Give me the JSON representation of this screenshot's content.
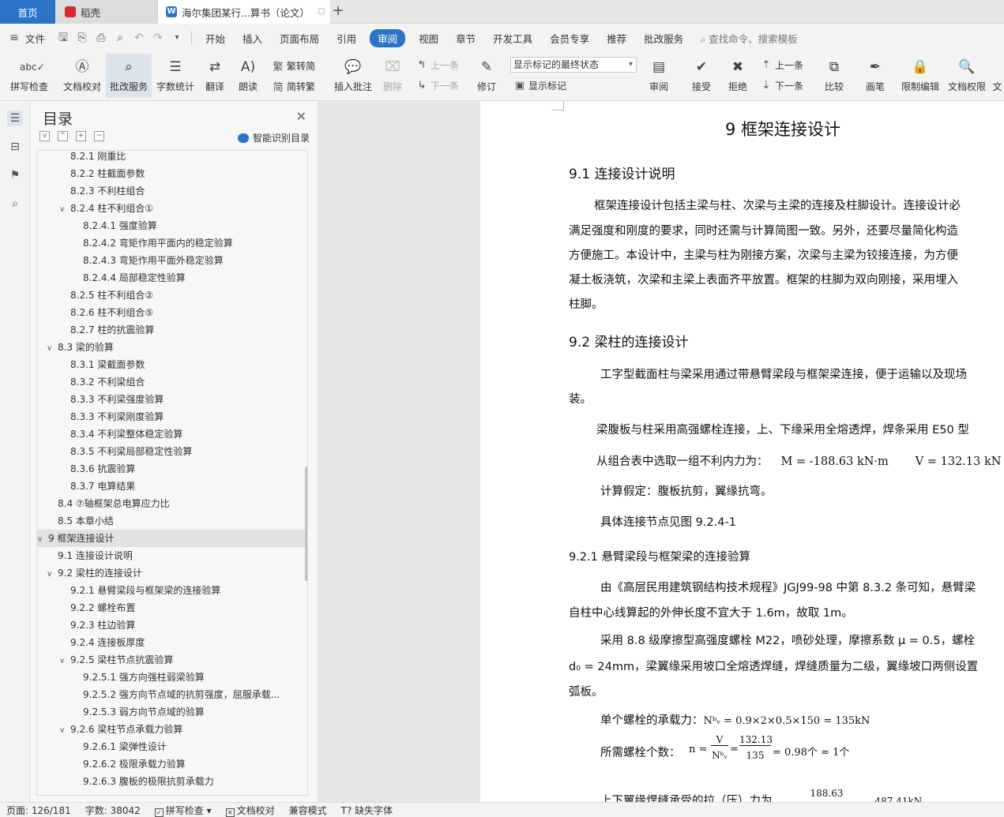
{
  "tabs": {
    "home": "首页",
    "docer": "稻壳",
    "doc": "海尔集团某行...算书（论文）",
    "add": "+"
  },
  "menu": {
    "file": "文件",
    "items": [
      "开始",
      "插入",
      "页面布局",
      "引用",
      "审阅",
      "视图",
      "章节",
      "开发工具",
      "会员专享",
      "推荐",
      "批改服务"
    ],
    "active": "审阅",
    "search": "查找命令、搜索模板"
  },
  "ribbon": {
    "spellcheck": "拼写检查",
    "doc_proof": "文档校对",
    "grading": "批改服务",
    "word_count": "字数统计",
    "translate": "翻译",
    "read_aloud": "朗读",
    "to_traditional": "繁转简",
    "to_simplified": "简转繁",
    "insert_comment": "插入批注",
    "delete": "删除",
    "prev_comment": "上一条",
    "next_comment": "下一条",
    "track_changes": "修订",
    "markup_mode": "显示标记的最终状态",
    "show_markup": "显示标记",
    "review": "审阅",
    "accept": "接受",
    "reject": "拒绝",
    "prev_change": "上一条",
    "next_change": "下一条",
    "compare": "比较",
    "pen": "画笔",
    "restrict_edit": "限制编辑",
    "doc_rights": "文档权限",
    "more": "文"
  },
  "toc": {
    "title": "目录",
    "smart": "智能识别目录",
    "items": [
      {
        "text": "8.2.1 刚重比",
        "level": 3,
        "caret": ""
      },
      {
        "text": "8.2.2 柱截面参数",
        "level": 3,
        "caret": ""
      },
      {
        "text": "8.2.3 不利柱组合",
        "level": 3,
        "caret": ""
      },
      {
        "text": "8.2.4 柱不利组合①",
        "level": 3,
        "caret": "v"
      },
      {
        "text": "8.2.4.1 强度验算",
        "level": 4,
        "caret": ""
      },
      {
        "text": "8.2.4.2 弯矩作用平面内的稳定验算",
        "level": 4,
        "caret": ""
      },
      {
        "text": "8.2.4.3 弯矩作用平面外稳定验算",
        "level": 4,
        "caret": ""
      },
      {
        "text": "8.2.4.4 局部稳定性验算",
        "level": 4,
        "caret": ""
      },
      {
        "text": "8.2.5 柱不利组合②",
        "level": 3,
        "caret": ""
      },
      {
        "text": "8.2.6 柱不利组合⑤",
        "level": 3,
        "caret": ""
      },
      {
        "text": "8.2.7 柱的抗震验算",
        "level": 3,
        "caret": ""
      },
      {
        "text": "8.3 梁的验算",
        "level": 2,
        "caret": "v"
      },
      {
        "text": "8.3.1 梁截面参数",
        "level": 3,
        "caret": ""
      },
      {
        "text": "8.3.2 不利梁组合",
        "level": 3,
        "caret": ""
      },
      {
        "text": "8.3.3 不利梁强度验算",
        "level": 3,
        "caret": ""
      },
      {
        "text": "8.3.3 不利梁刚度验算",
        "level": 3,
        "caret": ""
      },
      {
        "text": "8.3.4 不利梁整体稳定验算",
        "level": 3,
        "caret": ""
      },
      {
        "text": "8.3.5 不利梁局部稳定性验算",
        "level": 3,
        "caret": ""
      },
      {
        "text": "8.3.6 抗震验算",
        "level": 3,
        "caret": ""
      },
      {
        "text": "8.3.7 电算结果",
        "level": 3,
        "caret": ""
      },
      {
        "text": "8.4 ⑦轴框架总电算应力比",
        "level": 2,
        "caret": ""
      },
      {
        "text": "8.5 本章小结",
        "level": 2,
        "caret": ""
      },
      {
        "text": "9  框架连接设计",
        "level": 1,
        "caret": "v",
        "selected": true
      },
      {
        "text": "9.1 连接设计说明",
        "level": 2,
        "caret": ""
      },
      {
        "text": "9.2 梁柱的连接设计",
        "level": 2,
        "caret": "v"
      },
      {
        "text": "9.2.1 悬臂梁段与框架梁的连接验算",
        "level": 3,
        "caret": ""
      },
      {
        "text": "9.2.2 螺栓布置",
        "level": 3,
        "caret": ""
      },
      {
        "text": "9.2.3 柱边验算",
        "level": 3,
        "caret": ""
      },
      {
        "text": "9.2.4 连接板厚度",
        "level": 3,
        "caret": ""
      },
      {
        "text": "9.2.5 梁柱节点抗震验算",
        "level": 3,
        "caret": "v"
      },
      {
        "text": "9.2.5.1 强方向强柱弱梁验算",
        "level": 4,
        "caret": ""
      },
      {
        "text": "9.2.5.2 强方向节点域的抗剪强度，屈服承载...",
        "level": 4,
        "caret": ""
      },
      {
        "text": "9.2.5.3 弱方向节点域的验算",
        "level": 4,
        "caret": ""
      },
      {
        "text": "9.2.6 梁柱节点承载力验算",
        "level": 3,
        "caret": "v"
      },
      {
        "text": "9.2.6.1 梁弹性设计",
        "level": 4,
        "caret": ""
      },
      {
        "text": "9.2.6.2 极限承载力验算",
        "level": 4,
        "caret": ""
      },
      {
        "text": "9.2.6.3 腹板的极限抗剪承载力",
        "level": 4,
        "caret": ""
      }
    ]
  },
  "doc": {
    "h1": "9  框架连接设计",
    "h2a": "9.1 连接设计说明",
    "p1": [
      "框架连接设计包括主梁与柱、次梁与主梁的连接及柱脚设计。连接设计必",
      "满足强度和刚度的要求，同时还需与计算简图一致。另外，还要尽量简化构造",
      "方便施工。本设计中，主梁与柱为刚接方案，次梁与主梁为铰接连接，为方便",
      "凝土板浇筑，次梁和主梁上表面齐平放置。框架的柱脚为双向刚接，采用埋入",
      "柱脚。"
    ],
    "h2b": "9.2 梁柱的连接设计",
    "p2": [
      "工字型截面柱与梁采用通过带悬臂梁段与框架梁连接，便于运输以及现场",
      "装。"
    ],
    "p3": "梁腹板与柱采用高强螺栓连接，上、下缘采用全熔透焊，焊条采用 E50 型",
    "p4_label": "从组合表中选取一组不利内力为：",
    "p4_m": "M = -188.63 kN·m",
    "p4_v": "V = 132.13 kN",
    "p5": "计算假定：腹板抗剪，翼缘抗弯。",
    "p6": "具体连接节点见图 9.2.4-1",
    "h3": "9.2.1 悬臂梁段与框架梁的连接验算",
    "p7": [
      "由《高层民用建筑钢结构技术规程》JGJ99-98 中第 8.3.2 条可知，悬臂梁",
      "自柱中心线算起的外伸长度不宜大于 1.6m，故取 1m。"
    ],
    "p8": [
      "采用 8.8 级摩擦型高强度螺栓 M22，喷砂处理，摩擦系数 μ = 0.5，螺栓",
      "d₀ = 24mm，梁翼缘采用坡口全熔透焊缝，焊缝质量为二级，翼缘坡口两侧设置",
      "弧板。"
    ],
    "p9_label": "单个螺栓的承载力：",
    "p9_eq": "Nᵇᵥ = 0.9×2×0.5×150 = 135kN",
    "p10_label": "所需螺栓个数：",
    "p10_n": "n =",
    "p10_frac1_num": "V",
    "p10_frac1_den": "Nᵇᵥ",
    "p10_frac2_num": "132.13",
    "p10_frac2_den": "135",
    "p10_tail": "= 0.98个 ≈ 1个",
    "p11": "上下翼缘焊缝承受的拉（压）力为",
    "p11_num": "188.63",
    "p11_tail": "487.41kN"
  },
  "status": {
    "page": "页面: 126/181",
    "words": "字数: 38042",
    "spell": "拼写检查",
    "proof": "文档校对",
    "compat": "兼容模式",
    "font": "缺失字体"
  },
  "colors": {
    "accent": "#2b74c7",
    "docer": "#d9282f"
  }
}
